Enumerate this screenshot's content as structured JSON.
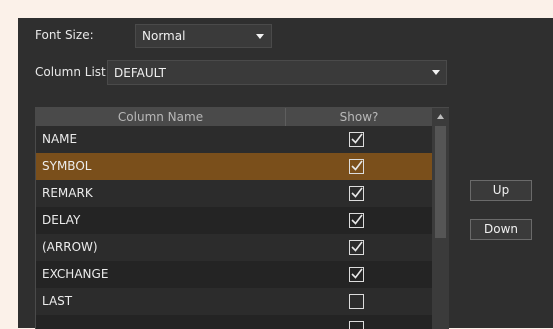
{
  "font_size": {
    "label": "Font Size:",
    "value": "Normal"
  },
  "column_list": {
    "label": "Column List",
    "value": "DEFAULT"
  },
  "table": {
    "headers": {
      "name": "Column Name",
      "show": "Show?"
    },
    "rows": [
      {
        "name": "NAME",
        "checked": true
      },
      {
        "name": "SYMBOL",
        "checked": true,
        "selected": true
      },
      {
        "name": "REMARK",
        "checked": true
      },
      {
        "name": "DELAY",
        "checked": true
      },
      {
        "name": "(ARROW)",
        "checked": true
      },
      {
        "name": "EXCHANGE",
        "checked": true
      },
      {
        "name": "LAST",
        "checked": false
      },
      {
        "name": "",
        "checked": false
      }
    ]
  },
  "buttons": {
    "up": "Up",
    "down": "Down"
  },
  "colors": {
    "selected_row": "#7a4f1b",
    "background": "#2f2f2f",
    "outer": "#fbf1e9"
  }
}
